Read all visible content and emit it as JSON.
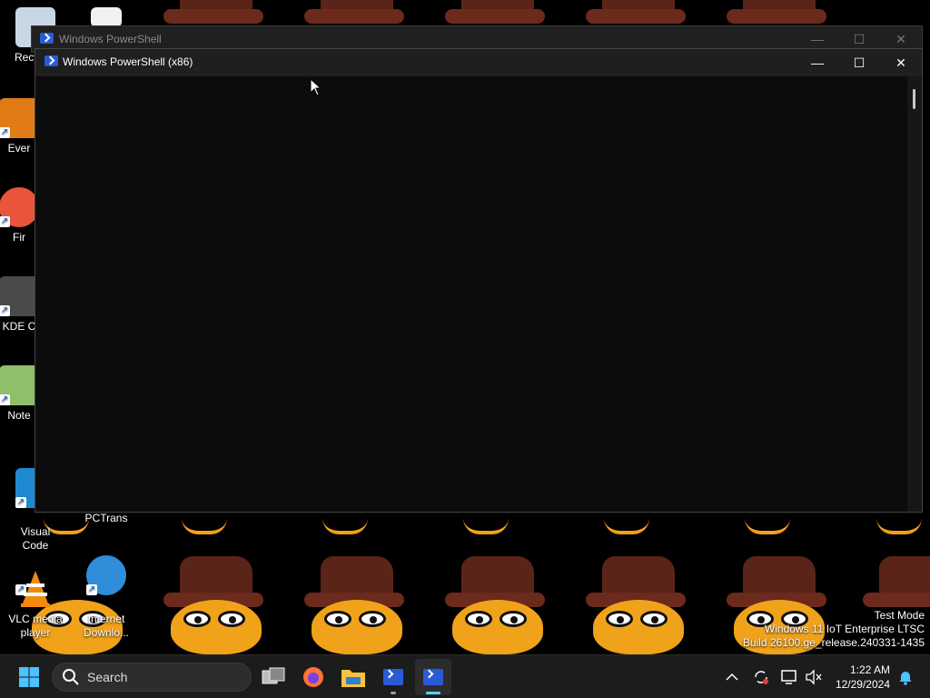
{
  "desktop": {
    "icons": [
      {
        "label": "Recycl..."
      },
      {
        "label": "Ever"
      },
      {
        "label": "Fir"
      },
      {
        "label": "KDE C"
      },
      {
        "label": "Note"
      },
      {
        "label": "Visual\nCode"
      },
      {
        "label": "PCTrans"
      },
      {
        "label": "VLC media\nplayer"
      },
      {
        "label": "Internet\nDownlo..."
      }
    ],
    "watermark": {
      "line1": "Test Mode",
      "line2": "Windows 11 IoT Enterprise LTSC",
      "line3": "Build 26100.ge_release.240331-1435"
    }
  },
  "windows": {
    "back": {
      "title": "Windows PowerShell"
    },
    "front": {
      "title": "Windows PowerShell (x86)"
    }
  },
  "controls": {
    "minimize": "—",
    "maximize": "☐",
    "close": "✕"
  },
  "taskbar": {
    "search_label": "Search",
    "time": "1:22 AM",
    "date": "12/29/2024"
  },
  "colors": {
    "taskbar": "#1c1c1c",
    "console": "#0c0c0c",
    "powershell_blue": "#2a5bd7",
    "accent_indicator": "#60cdff"
  }
}
